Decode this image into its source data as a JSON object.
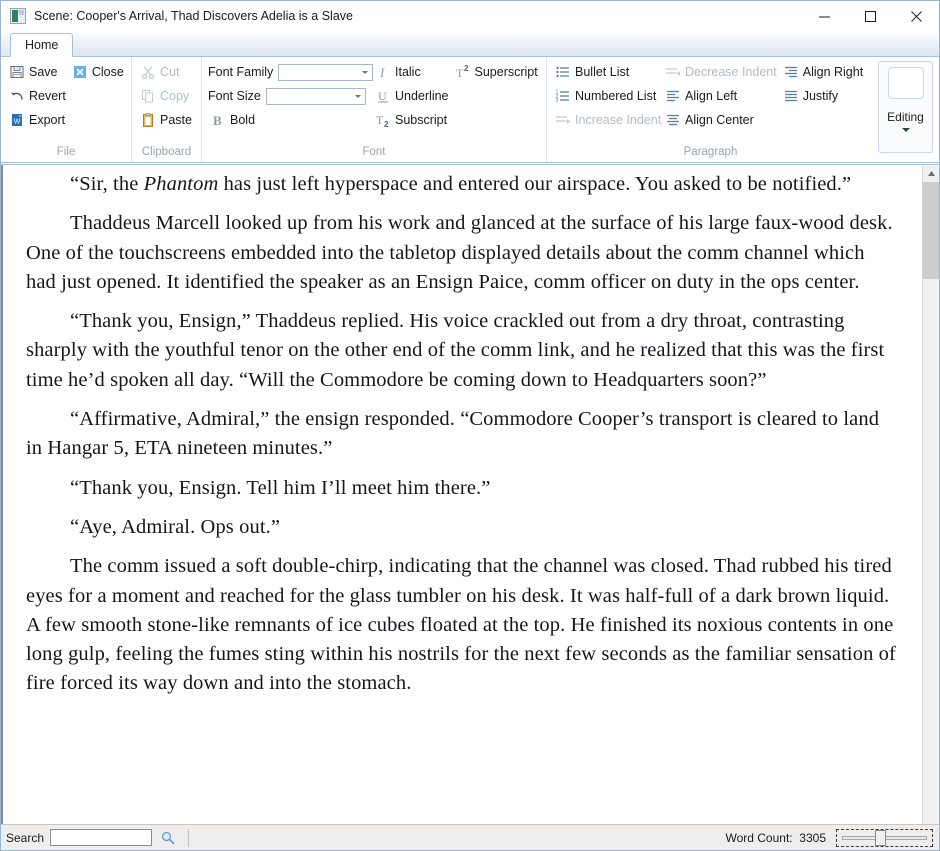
{
  "window": {
    "title": "Scene: Cooper's Arrival, Thad Discovers Adelia is a Slave",
    "icon": "document-icon",
    "minimize_label": "—",
    "maximize_label": "☐",
    "close_label": "✕"
  },
  "ribbon": {
    "tabs": [
      {
        "label": "Home",
        "active": true
      }
    ],
    "groups": [
      {
        "label": "File",
        "items": [
          {
            "label": "Save",
            "icon": "save-icon",
            "enabled": true
          },
          {
            "label": "Revert",
            "icon": "revert-icon",
            "enabled": true
          },
          {
            "label": "Export",
            "icon": "export-icon",
            "enabled": true
          },
          {
            "label": "Close",
            "icon": "close-x-icon",
            "enabled": true
          }
        ]
      },
      {
        "label": "Clipboard",
        "items": [
          {
            "label": "Cut",
            "icon": "cut-icon",
            "enabled": false
          },
          {
            "label": "Copy",
            "icon": "copy-icon",
            "enabled": false
          },
          {
            "label": "Paste",
            "icon": "paste-icon",
            "enabled": true
          }
        ]
      },
      {
        "label": "Font",
        "font_family_label": "Font Family",
        "font_family_value": "",
        "font_size_label": "Font Size",
        "font_size_value": "",
        "items": [
          {
            "label": "Bold",
            "icon": "bold-icon",
            "enabled": true
          },
          {
            "label": "Italic",
            "icon": "italic-icon",
            "enabled": true
          },
          {
            "label": "Underline",
            "icon": "underline-icon",
            "enabled": true
          },
          {
            "label": "Subscript",
            "icon": "subscript-icon",
            "enabled": true
          },
          {
            "label": "Superscript",
            "icon": "superscript-icon",
            "enabled": true
          }
        ]
      },
      {
        "label": "Paragraph",
        "items": [
          {
            "label": "Bullet List",
            "icon": "bullet-list-icon",
            "enabled": true
          },
          {
            "label": "Numbered List",
            "icon": "numbered-list-icon",
            "enabled": true
          },
          {
            "label": "Increase Indent",
            "icon": "increase-indent-icon",
            "enabled": false
          },
          {
            "label": "Decrease Indent",
            "icon": "decrease-indent-icon",
            "enabled": false
          },
          {
            "label": "Align Left",
            "icon": "align-left-icon",
            "enabled": true
          },
          {
            "label": "Align Center",
            "icon": "align-center-icon",
            "enabled": true
          },
          {
            "label": "Align Right",
            "icon": "align-right-icon",
            "enabled": true
          },
          {
            "label": "Justify",
            "icon": "justify-icon",
            "enabled": true
          }
        ]
      }
    ],
    "editing": {
      "label": "Editing",
      "caret": "chevron-down-icon"
    }
  },
  "document": {
    "paragraphs": [
      {
        "pre": "“Sir, the ",
        "em": "Phantom",
        "post": " has just left hyperspace and entered our airspace. You asked to be notified.”"
      },
      {
        "text": "Thaddeus Marcell looked up from his work and glanced at the surface of his large faux-wood desk. One of the touchscreens embedded into the tabletop displayed details about the comm channel which had just opened. It identified the speaker as an Ensign Paice, comm officer on duty in the ops center."
      },
      {
        "text": "“Thank you, Ensign,” Thaddeus replied. His voice crackled out from a dry throat, contrasting sharply with the youthful tenor on the other end of the comm link, and he realized that this was the first time he’d spoken all day. “Will the Commodore be coming down to Headquarters soon?”"
      },
      {
        "text": "“Affirmative, Admiral,” the ensign responded. “Commodore Cooper’s transport is cleared to land in Hangar 5, ETA nineteen minutes.”"
      },
      {
        "text": "“Thank you, Ensign. Tell him I’ll meet him there.”"
      },
      {
        "text": "“Aye, Admiral. Ops out.”"
      },
      {
        "text": "The comm issued a soft double-chirp, indicating that the channel was closed. Thad rubbed his tired eyes for a moment and reached for the glass tumbler on his desk. It was half-full of a dark brown liquid. A few smooth stone-like remnants of ice cubes floated at the top. He finished its noxious contents in one long gulp, feeling the fumes sting within his nostrils for the next few seconds as the familiar sensation of fire forced its way down and into the stomach."
      }
    ]
  },
  "statusbar": {
    "search_label": "Search",
    "search_value": "",
    "search_placeholder": "",
    "search_button_icon": "search-icon",
    "word_count_label": "Word Count:",
    "word_count_value": "3305",
    "zoom_slider": "zoom-slider"
  },
  "colors": {
    "accent_blue": "#2a6fb5",
    "ribbon_border": "#a8c0d8",
    "group_label": "#9aa5b1",
    "disabled_text": "#b2bcc6",
    "status_bg": "#efeeec",
    "scroll_thumb": "#cdcdcd"
  }
}
